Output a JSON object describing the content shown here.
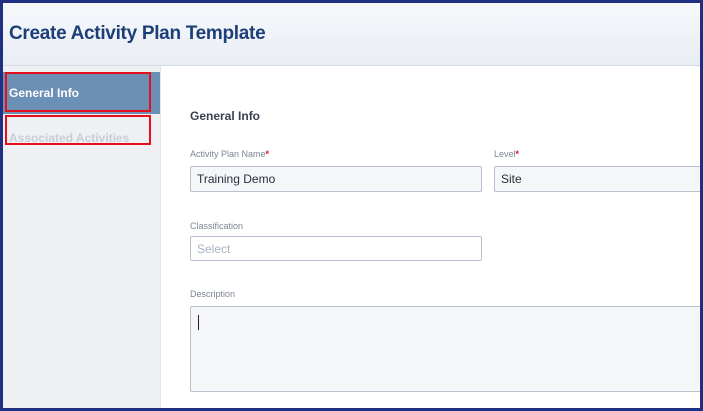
{
  "header": {
    "title": "Create Activity Plan Template"
  },
  "sidebar": {
    "items": [
      {
        "label": "General Info",
        "active": true
      },
      {
        "label": "Associated Activities",
        "active": false
      }
    ]
  },
  "form": {
    "section_title": "General Info",
    "activity_plan_name": {
      "label": "Activity Plan Name",
      "required_mark": "*",
      "value": "Training Demo"
    },
    "level": {
      "label": "Level",
      "required_mark": "*",
      "value": "Site"
    },
    "classification": {
      "label": "Classification",
      "placeholder": "Select",
      "value": ""
    },
    "description": {
      "label": "Description",
      "value": ""
    }
  },
  "colors": {
    "outer_border": "#1f2f82",
    "title": "#1d3f78",
    "active_nav": "#6c8fb5",
    "highlight_box": "#e3101b",
    "required_mark": "#d8101c"
  }
}
